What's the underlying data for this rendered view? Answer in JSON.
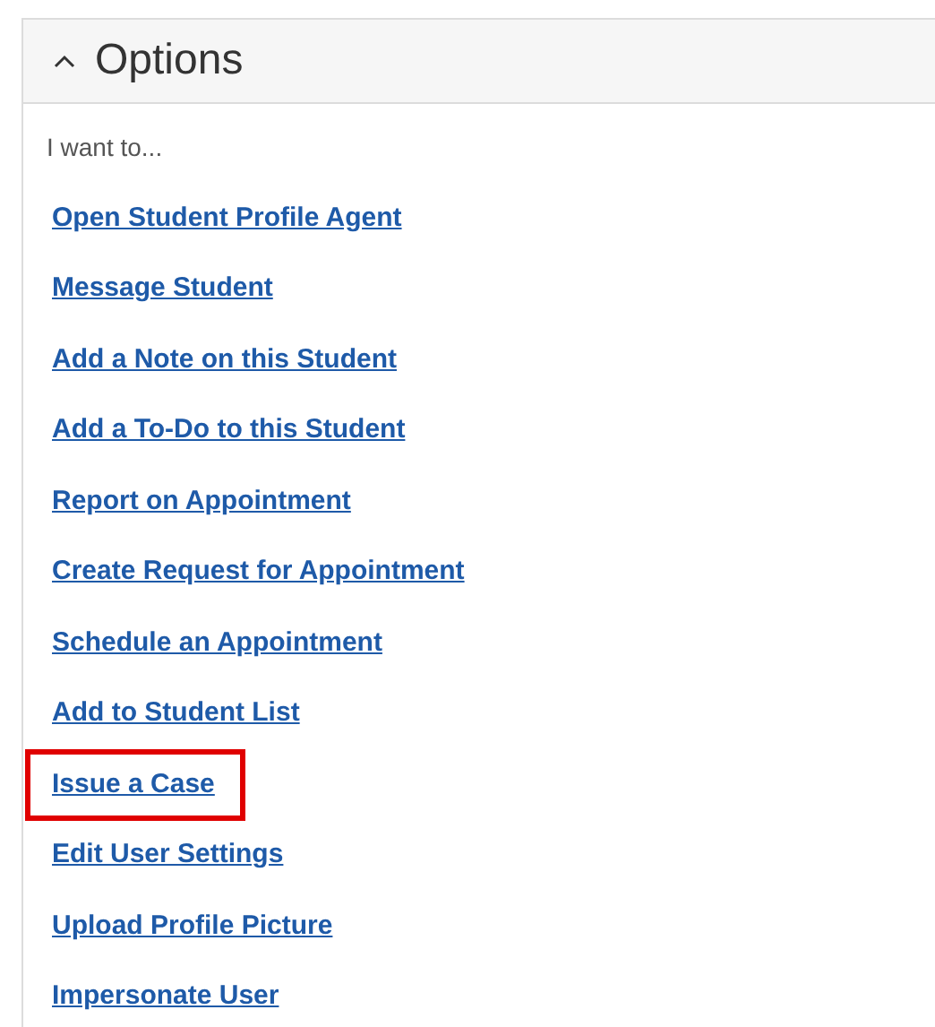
{
  "panel": {
    "title": "Options",
    "expanded": true
  },
  "intro": "I want to...",
  "links": [
    {
      "label": "Open Student Profile Agent",
      "highlighted": false
    },
    {
      "label": "Message Student",
      "highlighted": false
    },
    {
      "label": "Add a Note on this Student",
      "highlighted": false
    },
    {
      "label": "Add a To-Do to this Student",
      "highlighted": false
    },
    {
      "label": "Report on Appointment",
      "highlighted": false
    },
    {
      "label": "Create Request for Appointment",
      "highlighted": false
    },
    {
      "label": "Schedule an Appointment",
      "highlighted": false
    },
    {
      "label": "Add to Student List",
      "highlighted": false
    },
    {
      "label": "Issue a Case",
      "highlighted": true
    },
    {
      "label": "Edit User Settings",
      "highlighted": false
    },
    {
      "label": "Upload Profile Picture",
      "highlighted": false
    },
    {
      "label": "Impersonate User",
      "highlighted": false
    }
  ]
}
